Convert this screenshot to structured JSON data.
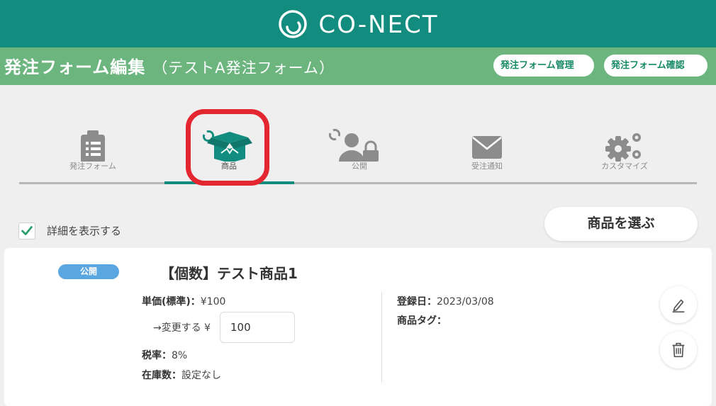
{
  "brand": {
    "name": "CO-NECT"
  },
  "header": {
    "title": "発注フォーム編集",
    "subtitle": "（テストA発注フォーム）",
    "manage_label": "発注フォーム管理",
    "confirm_label": "発注フォーム確認"
  },
  "tabs": [
    {
      "label": "発注フォーム",
      "icon": "clipboard-icon",
      "active": false
    },
    {
      "label": "商品",
      "icon": "box-icon",
      "active": true
    },
    {
      "label": "公開",
      "icon": "user-lock-icon",
      "active": false
    },
    {
      "label": "受注通知",
      "icon": "envelope-icon",
      "active": false
    },
    {
      "label": "カスタマイズ",
      "icon": "gears-icon",
      "active": false
    }
  ],
  "detail_toggle": {
    "label": "詳細を表示する",
    "checked": true
  },
  "choose_button": "商品を選ぶ",
  "product": {
    "status": "公開",
    "name": "【個数】テスト商品1",
    "unit_price_label": "単価(標準)：",
    "unit_price_value": "¥100",
    "change_label": "→変更する ¥",
    "change_value": "100",
    "tax_label": "税率：",
    "tax_value": "8%",
    "stock_label": "在庫数：",
    "stock_value": "設定なし",
    "registered_label": "登録日：",
    "registered_value": "2023/03/08",
    "tag_label": "商品タグ：",
    "tag_value": ""
  },
  "colors": {
    "brand": "#128c7e",
    "titlebar": "#6cb57f",
    "badge": "#5aa6e0",
    "highlight": "#e3262f"
  }
}
